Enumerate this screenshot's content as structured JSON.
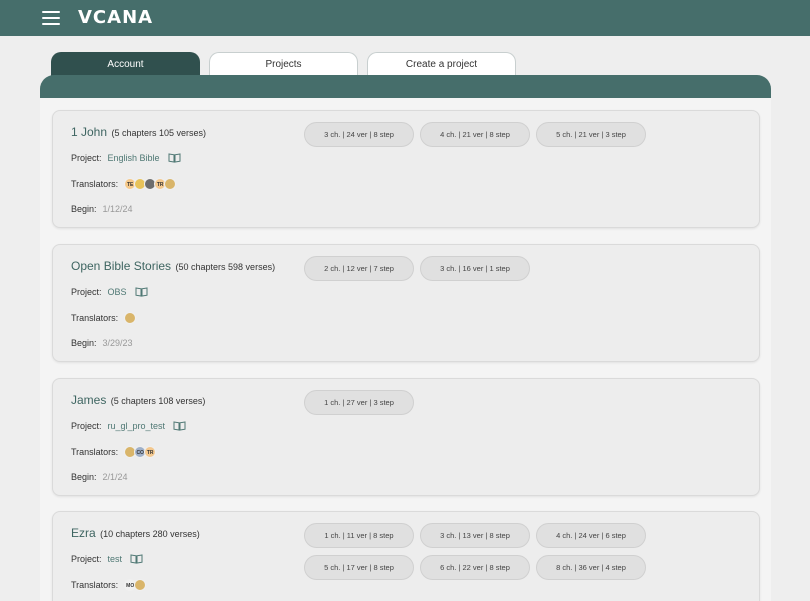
{
  "app": {
    "logo": "VCANA"
  },
  "tabs": [
    {
      "label": "Account",
      "active": true
    },
    {
      "label": "Projects",
      "active": false
    },
    {
      "label": "Create a project",
      "active": false
    }
  ],
  "labels": {
    "project": "Project:",
    "translators": "Translators:",
    "begin": "Begin:"
  },
  "cards": [
    {
      "name": "1 John",
      "meta": "(5 chapters 105 verses)",
      "project": "English Bible",
      "begin": "1/12/24",
      "translators": [
        "TE",
        "",
        "",
        "TR",
        ""
      ],
      "chips": [
        "3 ch.  |  24 ver  |  8 step",
        "4 ch.  |  21 ver  |  8 step",
        "5 ch.  |  21 ver  |  3 step"
      ]
    },
    {
      "name": "Open Bible Stories",
      "meta": "(50 chapters 598 verses)",
      "project": "OBS",
      "begin": "3/29/23",
      "translators": [
        ""
      ],
      "chips": [
        "2 ch.  |  12 ver  |  7 step",
        "3 ch.  |  16 ver  |  1 step"
      ]
    },
    {
      "name": "James",
      "meta": "(5 chapters 108 verses)",
      "project": "ru_gl_pro_test",
      "begin": "2/1/24",
      "translators": [
        "",
        "CO",
        "TR"
      ],
      "chips": [
        "1 ch.  |  27 ver  |  3 step"
      ]
    },
    {
      "name": "Ezra",
      "meta": "(10 chapters 280 verses)",
      "project": "test",
      "begin": "",
      "translators": [
        "MO",
        ""
      ],
      "chips": [
        "1 ch.  |  11 ver  |  8 step",
        "3 ch.  |  13 ver  |  8 step",
        "4 ch.  |  24 ver  |  6 step",
        "5 ch.  |  17 ver  |  8 step",
        "6 ch.  |  22 ver  |  8 step",
        "8 ch.  |  36 ver  |  4 step"
      ]
    }
  ],
  "colors": {
    "header": "#466e6b",
    "active_tab": "#30504e",
    "link": "#4f7874"
  }
}
